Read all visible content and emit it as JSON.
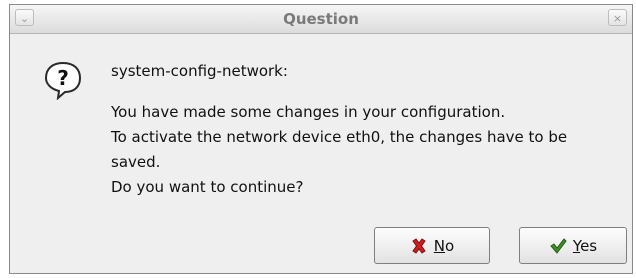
{
  "window": {
    "title": "Question",
    "menu_icon": "chevron-down-icon",
    "close_icon": "close-icon"
  },
  "message": {
    "icon": "question-icon",
    "header": "system-config-network:",
    "lines": [
      "You have made some changes in your configuration.",
      "To activate the network device eth0, the changes have to be",
      "saved.",
      "Do you want to continue?"
    ]
  },
  "buttons": {
    "no": {
      "label": "No",
      "icon": "red-x-icon"
    },
    "yes": {
      "label": "Yes",
      "icon": "green-check-icon"
    }
  },
  "colors": {
    "no_icon": "#cc1f1f",
    "yes_icon": "#3f8f2a",
    "question_icon_fill": "#ffffff",
    "question_icon_stroke": "#2a2a2a"
  }
}
